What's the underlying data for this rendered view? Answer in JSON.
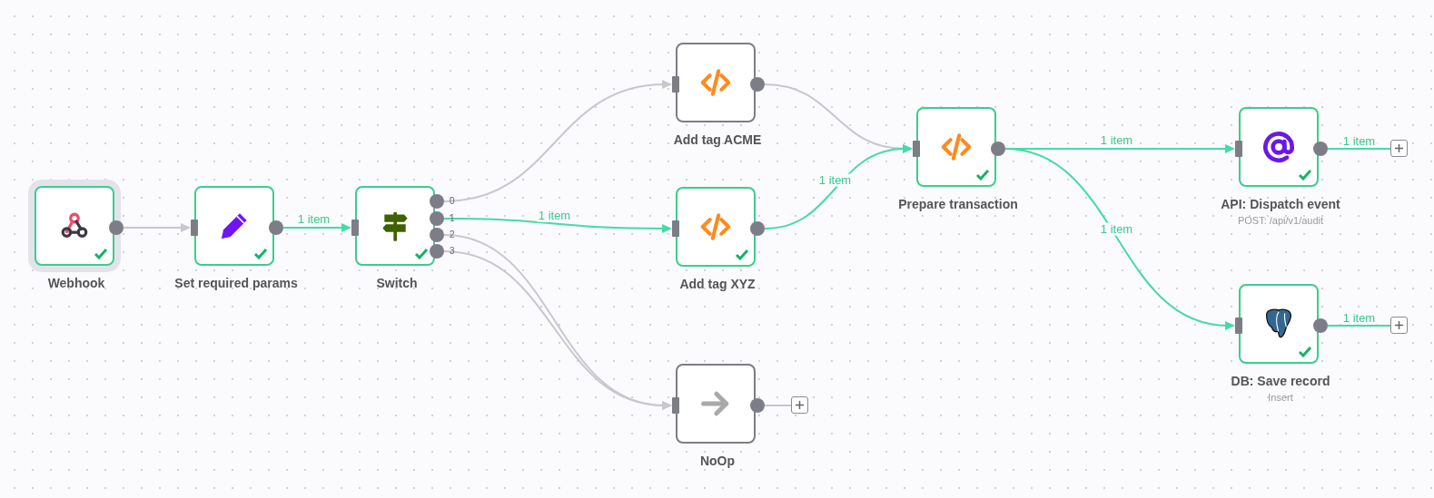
{
  "nodes": [
    {
      "title": "Webhook",
      "kind": "webhook",
      "succeeded": true,
      "selected": true
    },
    {
      "title": "Set required params",
      "kind": "set",
      "succeeded": true,
      "selected": false
    },
    {
      "title": "Switch",
      "kind": "switch",
      "succeeded": true,
      "selected": false,
      "outputs": [
        "0",
        "1",
        "2",
        "3"
      ]
    },
    {
      "title": "Add tag ACME",
      "kind": "code",
      "succeeded": false,
      "selected": false
    },
    {
      "title": "Add tag XYZ",
      "kind": "code",
      "succeeded": true,
      "selected": false
    },
    {
      "title": "NoOp",
      "kind": "noop",
      "succeeded": false,
      "selected": false,
      "end_stub": {
        "active": false
      }
    },
    {
      "title": "Prepare transaction",
      "kind": "code",
      "succeeded": true,
      "selected": false
    },
    {
      "title": "API: Dispatch event",
      "subtitle": "POST: /api/v1/audit",
      "kind": "email",
      "succeeded": true,
      "selected": false,
      "end_stub": {
        "active": true,
        "label": "1 item"
      }
    },
    {
      "title": "DB: Save record",
      "subtitle": "Insert",
      "kind": "postgres",
      "succeeded": true,
      "selected": false,
      "end_stub": {
        "active": true,
        "label": "1 item"
      }
    }
  ],
  "connections": [
    {
      "active": false
    },
    {
      "active": true,
      "label": "1 item"
    },
    {
      "active": false
    },
    {
      "active": true,
      "label": "1 item"
    },
    {
      "active": false
    },
    {
      "active": false
    },
    {
      "active": false
    },
    {
      "active": true,
      "label": "1 item"
    },
    {
      "active": true,
      "label": "1 item"
    },
    {
      "active": true,
      "label": "1 item"
    }
  ]
}
